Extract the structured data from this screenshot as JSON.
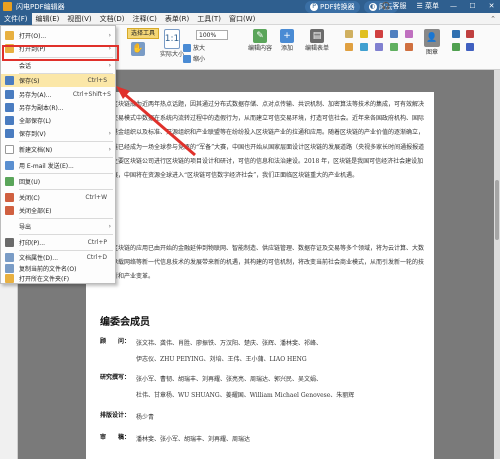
{
  "titlebar": {
    "app_name": "闪电PDF编辑器",
    "converter": "PDF转换器",
    "skin": "风云",
    "service": "客服",
    "menu": "菜单"
  },
  "menubar": {
    "items": [
      "文件(F)",
      "编辑(E)",
      "视图(V)",
      "文档(D)",
      "注释(C)",
      "表单(R)",
      "工具(T)",
      "窗口(W)"
    ],
    "active_index": 0
  },
  "toolbar": {
    "zoom_value": "100%",
    "selected_tool": "选择工具",
    "buttons": {
      "actual_size": "实际大小",
      "zoom_in": "放大",
      "zoom_out": "缩小",
      "edit_content": "编辑内容",
      "add": "添加",
      "edit_form": "编辑表单",
      "stamp": "图章"
    }
  },
  "file_menu": {
    "items": [
      {
        "label": "打开(O)...",
        "shortcut": "",
        "submenu": true
      },
      {
        "label": "打开到(P)",
        "shortcut": "",
        "submenu": true
      },
      {
        "label": "会话",
        "shortcut": "",
        "submenu": true
      },
      {
        "label": "保存(S)",
        "shortcut": "Ctrl+S",
        "submenu": false
      },
      {
        "label": "另存为(A)...",
        "shortcut": "Ctrl+Shift+S",
        "submenu": false
      },
      {
        "label": "另存为副本(R)...",
        "shortcut": "",
        "submenu": false
      },
      {
        "label": "全部保存(L)",
        "shortcut": "",
        "submenu": false
      },
      {
        "label": "保存到(V)",
        "shortcut": "",
        "submenu": true
      },
      {
        "label": "新建文档(N)",
        "shortcut": "",
        "submenu": true
      },
      {
        "label": "用 E-mail 发送(E)...",
        "shortcut": "",
        "submenu": false
      },
      {
        "label": "回复(U)",
        "shortcut": "",
        "submenu": false
      },
      {
        "label": "关闭(C)",
        "shortcut": "Ctrl+W",
        "submenu": false
      },
      {
        "label": "关闭全部(E)",
        "shortcut": "",
        "submenu": false
      },
      {
        "label": "导出",
        "shortcut": "",
        "submenu": true
      },
      {
        "label": "打印(P)...",
        "shortcut": "Ctrl+P",
        "submenu": false
      },
      {
        "label": "文档属性(D)...",
        "shortcut": "Ctrl+D",
        "submenu": false
      },
      {
        "label": "复制当前的文件名(O)",
        "shortcut": "",
        "submenu": false
      },
      {
        "label": "打开所在文件夹(F)",
        "shortcut": "",
        "submenu": false
      }
    ]
  },
  "document": {
    "paragraph1": "区块链成为近两年热点话题，因其通过分布式数据存储、点对点传输、共识机制、加密算法等技术的集成，可有效解决传统交易模式中数据在系统内流转过程中的造假行为，从而建立可信交易环境，打造可信社会。近年来各国政府机构、国际货币基金组织以及标准、开源组织和产业联盟等在纷纷投入区块链产业的拉通和应用。随着区块链的产业价值的逐渐确立，区块链已经成为一场全球参与竞逐的“军备”大赛，中国也开始从国家层面设计区块链的发展道路（央视多家长时间通报报道国内主要区块链公司进行区块链的项目设计和研讨，可信的信息和法治建设。2018 年，区块链是我国可信经济社会建设加速发展，中国将在资源全球进入“区块链可信数字经济社会”，我们正面临区块链重大的产业机遇。",
    "paragraph2": "区块链的应用已由开始的金融延伸到物联网、智能制造、供应链管理、数据存证及交易等多个领域，将为云计算、大数据、承载网络等新一代信息技术的发展带来新的机遇，其构建的可信机制，将改变当前社会商业模式，从而引发新一轮的技术创新和产业变革。",
    "section_title": "编委会成员",
    "credits": [
      {
        "label": "顾　　问：",
        "lines": [
          "张文祎、龚伟、肖胜、廖振铁、万汉阳、楚庆、张辉、潘林斐、祁峰、",
          "伊志仪、ZHU PEIYING、刘培、王伟、王小蒲、LIAO HENG"
        ]
      },
      {
        "label": "研究撰写：",
        "lines": [
          "张小军、曹韧、胡瑞丰、刘再耀、张亮亮、周瑞达、郭兴民、吴文娟、",
          "杜伟、甘章杨、WU SHUANG、姜耀国、William Michael Genovese、朱丽辉"
        ]
      },
      {
        "label": "排版设计：",
        "lines": [
          "杨少青"
        ]
      },
      {
        "label": "审　　稿：",
        "lines": [
          "潘林斐、张小军、胡瑞丰、刘再耀、周瑞达"
        ]
      }
    ]
  },
  "colors": {
    "titlebar": "#2f5f8f",
    "highlight_box": "#e0312b",
    "selected_tool": "#f4d676"
  }
}
